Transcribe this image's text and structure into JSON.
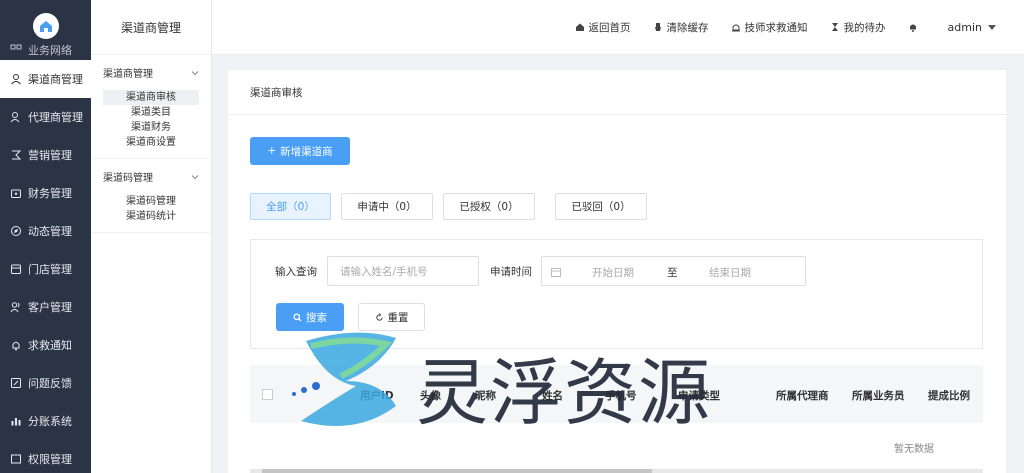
{
  "sidebar": {
    "items": [
      {
        "label": "业务网络",
        "icon": "grid-icon"
      },
      {
        "label": "渠道商管理",
        "icon": "user-icon"
      },
      {
        "label": "代理商管理",
        "icon": "agent-icon"
      },
      {
        "label": "营销管理",
        "icon": "marketing-icon"
      },
      {
        "label": "财务管理",
        "icon": "wallet-icon"
      },
      {
        "label": "动态管理",
        "icon": "compass-icon"
      },
      {
        "label": "门店管理",
        "icon": "store-icon"
      },
      {
        "label": "客户管理",
        "icon": "customers-icon"
      },
      {
        "label": "求救通知",
        "icon": "bell-icon"
      },
      {
        "label": "问题反馈",
        "icon": "feedback-icon"
      },
      {
        "label": "分账系统",
        "icon": "chart-icon"
      },
      {
        "label": "权限管理",
        "icon": "permission-icon"
      }
    ]
  },
  "submenu": {
    "title": "渠道商管理",
    "groups": [
      {
        "title": "渠道商管理",
        "links": [
          "渠道商审核",
          "渠道类目",
          "渠道财务",
          "渠道商设置"
        ]
      },
      {
        "title": "渠道码管理",
        "links": [
          "渠道码管理",
          "渠道码统计"
        ]
      }
    ]
  },
  "topbar": {
    "home": "返回首页",
    "clear_cache": "清除缓存",
    "tech_notice": "技师求救通知",
    "todo": "我的待办",
    "user": "admin"
  },
  "main": {
    "title": "渠道商审核",
    "add_button": "新增渠道商",
    "tabs": [
      "全部（0）",
      "申请中（0）",
      "已授权（0）",
      "已驳回（0）"
    ],
    "filter": {
      "query_label": "输入查询",
      "query_placeholder": "请输入姓名/手机号",
      "time_label": "申请时间",
      "start_placeholder": "开始日期",
      "to": "至",
      "end_placeholder": "结束日期",
      "search_button": "搜索",
      "reset_button": "重置"
    },
    "table": {
      "columns": [
        "用户ID",
        "头像",
        "昵称",
        "姓名",
        "手机号",
        "申请类型",
        "所属代理商",
        "所属业务员",
        "提成比例"
      ],
      "empty_text": "暂无数据"
    }
  },
  "watermark": {
    "text": "灵浮资源"
  }
}
